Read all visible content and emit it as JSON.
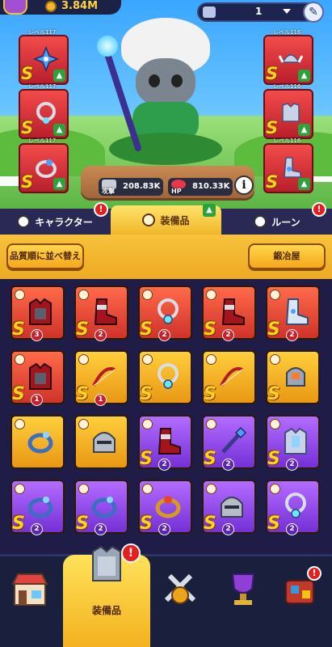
{
  "currency": {
    "amount": "3.84M"
  },
  "stage_selector": {
    "value": "1"
  },
  "left_slots": [
    {
      "level": "レベル117",
      "rank": "S"
    },
    {
      "level": "レベル117",
      "rank": "S"
    },
    {
      "level": "レベル117",
      "rank": "S"
    }
  ],
  "right_slots": [
    {
      "level": "レベル116",
      "rank": "S"
    },
    {
      "level": "レベル116",
      "rank": "S"
    },
    {
      "level": "レベル116",
      "rank": "S"
    }
  ],
  "stats": {
    "attack_label": "攻撃",
    "attack_value": "208.83K",
    "hp_label": "HP",
    "hp_value": "810.33K",
    "info_icon": "i"
  },
  "tabs": [
    {
      "label": "キャラクター",
      "badge": "!"
    },
    {
      "label": "装備品",
      "up": "▲"
    },
    {
      "label": "ルーン",
      "badge": "!"
    }
  ],
  "toolbar": {
    "sort_label": "品質順に並べ替え",
    "forge_label": "鍛冶屋"
  },
  "items": [
    {
      "color": "red",
      "rank": "S",
      "count": "3",
      "icon": "armor-icon"
    },
    {
      "color": "red",
      "rank": "S",
      "count": "2",
      "icon": "boots-icon"
    },
    {
      "color": "red",
      "rank": "S",
      "count": "2",
      "icon": "necklace-icon"
    },
    {
      "color": "red",
      "rank": "S",
      "count": "2",
      "icon": "boots-icon"
    },
    {
      "color": "red",
      "rank": "S",
      "count": "2",
      "icon": "winged-boots-icon"
    },
    {
      "color": "red",
      "rank": "S",
      "count": "1",
      "icon": "armor-icon"
    },
    {
      "color": "gold",
      "rank": "S",
      "count": "1",
      "icon": "bow-icon"
    },
    {
      "color": "gold",
      "rank": "S",
      "count": "",
      "icon": "necklace-icon"
    },
    {
      "color": "gold",
      "rank": "S",
      "count": "",
      "icon": "bow-icon"
    },
    {
      "color": "gold",
      "rank": "S",
      "count": "",
      "icon": "shoulder-armor-icon"
    },
    {
      "color": "gold",
      "rank": "",
      "count": "",
      "icon": "ring-icon"
    },
    {
      "color": "gold",
      "rank": "",
      "count": "",
      "icon": "helmet-icon"
    },
    {
      "color": "purple",
      "rank": "S",
      "count": "2",
      "icon": "boots-icon"
    },
    {
      "color": "purple",
      "rank": "S",
      "count": "2",
      "icon": "staff-icon"
    },
    {
      "color": "purple",
      "rank": "S",
      "count": "2",
      "icon": "chest-armor-icon"
    },
    {
      "color": "purple",
      "rank": "S",
      "count": "2",
      "icon": "ring-icon"
    },
    {
      "color": "purple",
      "rank": "S",
      "count": "2",
      "icon": "ring-icon"
    },
    {
      "color": "purple",
      "rank": "S",
      "count": "2",
      "icon": "gold-ring-icon"
    },
    {
      "color": "purple",
      "rank": "S",
      "count": "2",
      "icon": "helmet-icon"
    },
    {
      "color": "purple",
      "rank": "S",
      "count": "2",
      "icon": "necklace-icon"
    }
  ],
  "nav": {
    "equipment_label": "装備品",
    "badge": "!"
  },
  "colors": {
    "red": "#d0322a",
    "gold": "#f0b629",
    "purple": "#7530d6",
    "accent_green": "#2aa33b"
  }
}
